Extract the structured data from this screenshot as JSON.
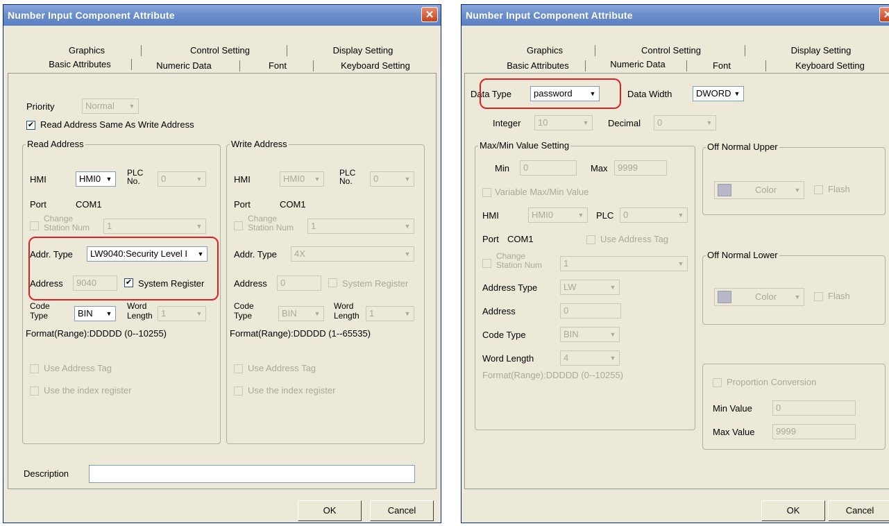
{
  "left": {
    "title": "Number Input Component Attribute",
    "tabs_back": [
      "Graphics",
      "Control Setting",
      "Display Setting"
    ],
    "tabs_front": [
      "Basic Attributes",
      "Numeric Data",
      "Font",
      "Keyboard Setting"
    ],
    "priority_label": "Priority",
    "priority_value": "Normal",
    "read_same_label": "Read Address Same As Write Address",
    "read": {
      "title": "Read Address",
      "hmi_label": "HMI",
      "hmi_value": "HMI0",
      "plc_label_1": "PLC",
      "plc_label_2": "No.",
      "plc_value": "0",
      "port_label": "Port",
      "port_value": "COM1",
      "change_1": "Change",
      "change_2": "Station Num",
      "station_value": "1",
      "addrtype_label": "Addr. Type",
      "addrtype_value": "LW9040:Security Level I",
      "address_label": "Address",
      "address_value": "9040",
      "sysreg_label": "System Register",
      "code_1": "Code",
      "code_2": "Type",
      "code_value": "BIN",
      "word_1": "Word",
      "word_2": "Length",
      "word_value": "1",
      "format": "Format(Range):DDDDD (0--10255)",
      "use_tag": "Use Address Tag",
      "use_index": "Use the index register"
    },
    "write": {
      "title": "Write Address",
      "hmi_label": "HMI",
      "hmi_value": "HMI0",
      "plc_label_1": "PLC",
      "plc_label_2": "No.",
      "plc_value": "0",
      "port_label": "Port",
      "port_value": "COM1",
      "change_1": "Change",
      "change_2": "Station Num",
      "station_value": "1",
      "addrtype_label": "Addr. Type",
      "addrtype_value": "4X",
      "address_label": "Address",
      "address_value": "0",
      "sysreg_label": "System Register",
      "code_1": "Code",
      "code_2": "Type",
      "code_value": "BIN",
      "word_1": "Word",
      "word_2": "Length",
      "word_value": "1",
      "format": "Format(Range):DDDDD (1--65535)",
      "use_tag": "Use Address Tag",
      "use_index": "Use the index register"
    },
    "description_label": "Description",
    "description_value": "",
    "ok": "OK",
    "cancel": "Cancel"
  },
  "right": {
    "title": "Number Input Component Attribute",
    "tabs_back": [
      "Graphics",
      "Control Setting",
      "Display Setting"
    ],
    "tabs_front": [
      "Basic Attributes",
      "Numeric Data",
      "Font",
      "Keyboard Setting"
    ],
    "datatype_label": "Data Type",
    "datatype_value": "password",
    "datawidth_label": "Data Width",
    "datawidth_value": "DWORD",
    "integer_label": "Integer",
    "integer_value": "10",
    "decimal_label": "Decimal",
    "decimal_value": "0",
    "maxmin": {
      "title": "Max/Min Value Setting",
      "min_label": "Min",
      "min_value": "0",
      "max_label": "Max",
      "max_value": "9999",
      "variable_label": "Variable Max/Min Value",
      "hmi_label": "HMI",
      "hmi_value": "HMI0",
      "plc_label": "PLC",
      "plc_value": "0",
      "port_label": "Port",
      "port_value": "COM1",
      "use_tag": "Use Address Tag",
      "change_1": "Change",
      "change_2": "Station Num",
      "station_value": "1",
      "addrtype_label": "Address Type",
      "addrtype_value": "LW",
      "address_label": "Address",
      "address_value": "0",
      "codetype_label": "Code Type",
      "codetype_value": "BIN",
      "wordlen_label": "Word Length",
      "wordlen_value": "4",
      "format": "Format(Range):DDDDD (0--10255)"
    },
    "upper": {
      "title": "Off Normal Upper",
      "color": "Color",
      "flash": "Flash"
    },
    "lower": {
      "title": "Off Normal Lower",
      "color": "Color",
      "flash": "Flash"
    },
    "proportion": {
      "label": "Proportion Conversion",
      "min_label": "Min Value",
      "min_value": "0",
      "max_label": "Max Value",
      "max_value": "9999"
    },
    "ok": "OK",
    "cancel": "Cancel"
  },
  "icons": {
    "close": "close-icon",
    "dropdown": "chevron-down-icon",
    "check": "checkmark-icon"
  },
  "colors": {
    "title_bar": "#6c8fcc",
    "dialog_bg": "#ece9d8",
    "highlight": "#e02020",
    "close": "#c8421d"
  }
}
